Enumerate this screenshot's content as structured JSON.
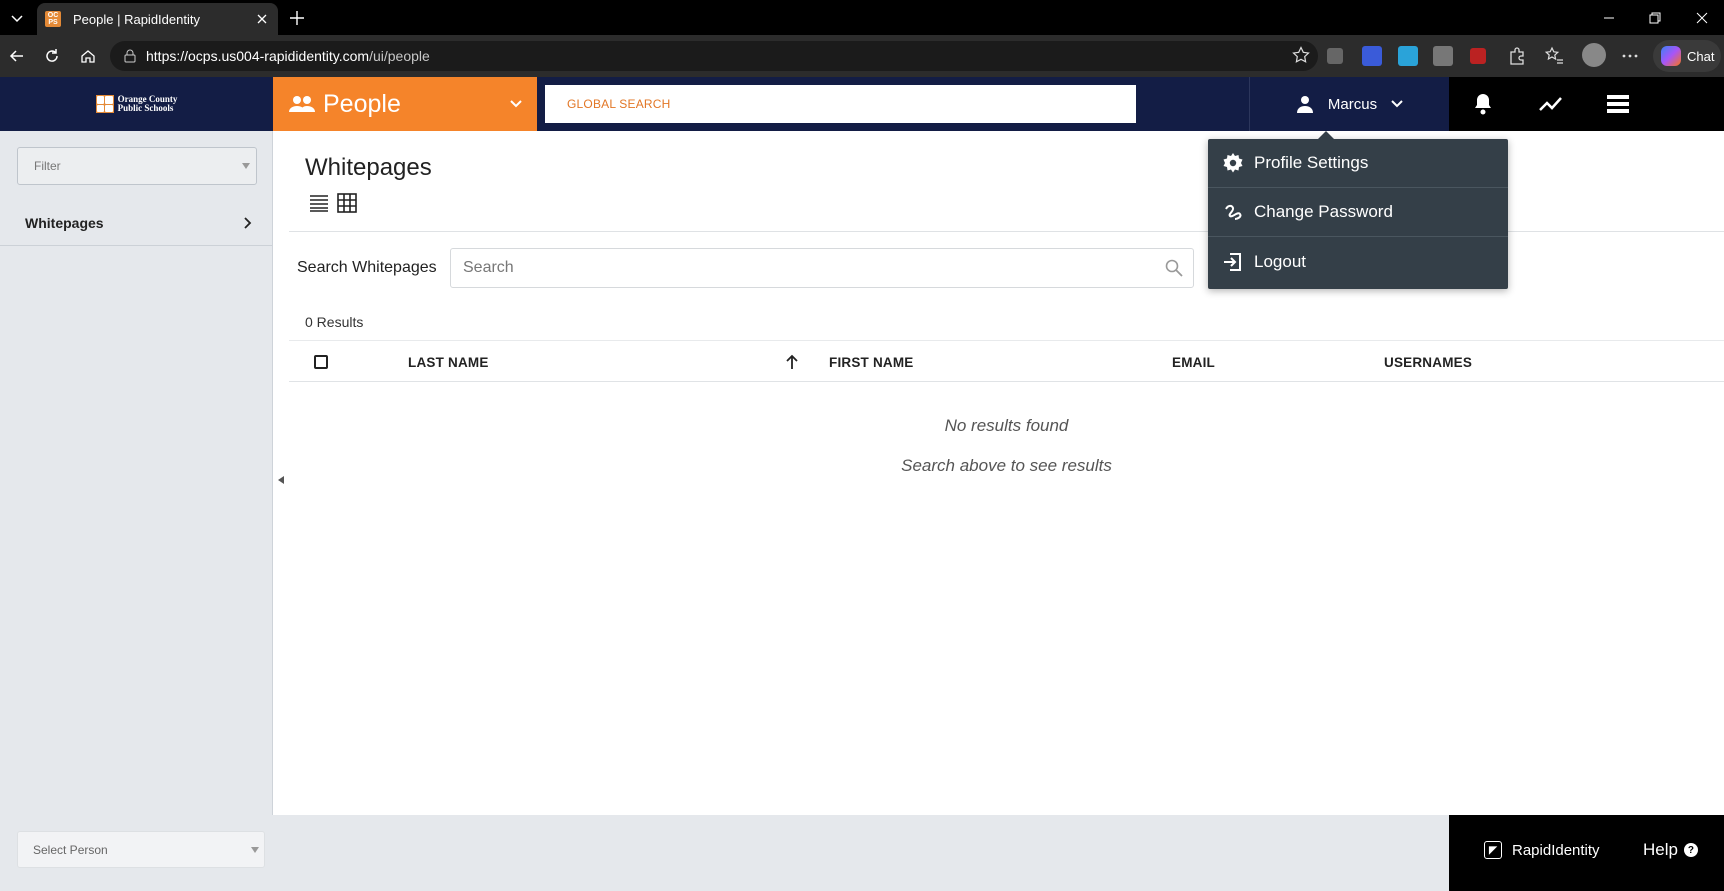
{
  "browser": {
    "tab_title": "People | RapidIdentity",
    "url_host": "https://ocps.us004-rapididentity.com",
    "url_path": "/ui/people",
    "chat_label": "Chat"
  },
  "header": {
    "logo_line1": "Orange County",
    "logo_line2": "Public Schools",
    "module_label": "People",
    "global_search_placeholder": "GLOBAL SEARCH",
    "user_name": "Marcus"
  },
  "sidebar": {
    "filter_placeholder": "Filter",
    "items": [
      {
        "label": "Whitepages"
      }
    ]
  },
  "main": {
    "title": "Whitepages",
    "search_label": "Search Whitepages",
    "search_placeholder": "Search",
    "results_count": "0 Results",
    "columns": [
      "LAST NAME",
      "FIRST NAME",
      "EMAIL",
      "USERNAMES"
    ],
    "empty_primary": "No results found",
    "empty_secondary": "Search above to see results"
  },
  "footer": {
    "select_person_placeholder": "Select Person",
    "brand_name": "RapidIdentity",
    "help_label": "Help"
  },
  "user_menu": {
    "items": [
      {
        "label": "Profile Settings",
        "icon": "gear-icon"
      },
      {
        "label": "Change Password",
        "icon": "password-icon"
      },
      {
        "label": "Logout",
        "icon": "logout-icon"
      }
    ]
  },
  "colors": {
    "nav_bg": "#131d45",
    "module_accent": "#f5842a",
    "sidebar_bg": "#e5e8ec",
    "menu_bg": "#343f48"
  }
}
